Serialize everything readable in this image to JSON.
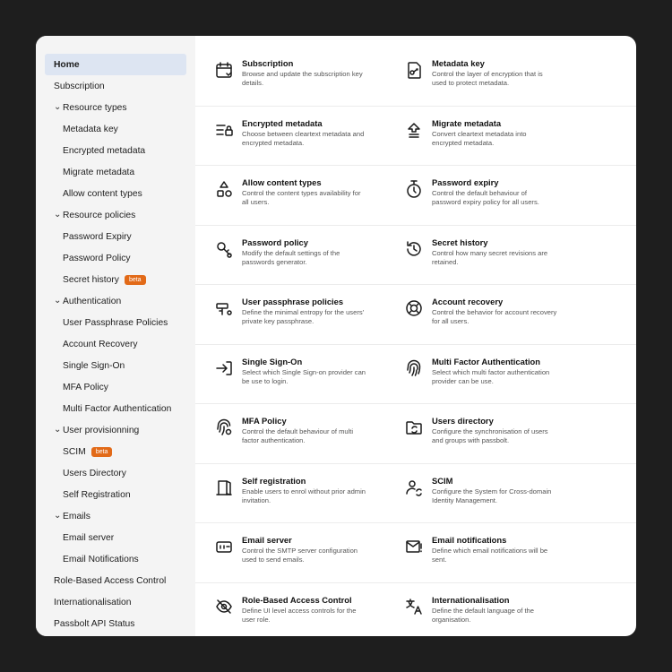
{
  "sidebar": {
    "items": [
      {
        "label": "Home",
        "level": 0,
        "active": true
      },
      {
        "label": "Subscription",
        "level": 0
      },
      {
        "label": "Resource types",
        "level": 1,
        "chevron": true
      },
      {
        "label": "Metadata key",
        "level": 2
      },
      {
        "label": "Encrypted metadata",
        "level": 2
      },
      {
        "label": "Migrate metadata",
        "level": 2
      },
      {
        "label": "Allow content types",
        "level": 2
      },
      {
        "label": "Resource policies",
        "level": 1,
        "chevron": true
      },
      {
        "label": "Password Expiry",
        "level": 2
      },
      {
        "label": "Password Policy",
        "level": 2
      },
      {
        "label": "Secret history",
        "level": 2,
        "badge": "beta"
      },
      {
        "label": "Authentication",
        "level": 1,
        "chevron": true
      },
      {
        "label": "User Passphrase Policies",
        "level": 2
      },
      {
        "label": "Account Recovery",
        "level": 2
      },
      {
        "label": "Single Sign-On",
        "level": 2
      },
      {
        "label": "MFA Policy",
        "level": 2
      },
      {
        "label": "Multi Factor Authentication",
        "level": 2
      },
      {
        "label": "User provisionning",
        "level": 1,
        "chevron": true
      },
      {
        "label": "SCIM",
        "level": 2,
        "badge": "beta"
      },
      {
        "label": "Users Directory",
        "level": 2
      },
      {
        "label": "Self Registration",
        "level": 2
      },
      {
        "label": "Emails",
        "level": 1,
        "chevron": true
      },
      {
        "label": "Email server",
        "level": 2
      },
      {
        "label": "Email Notifications",
        "level": 2
      },
      {
        "label": "Role-Based Access Control",
        "level": 0
      },
      {
        "label": "Internationalisation",
        "level": 0
      },
      {
        "label": "Passbolt API Status",
        "level": 0
      }
    ]
  },
  "cards": [
    {
      "title": "Subscription",
      "desc": "Browse and update the subscription key details.",
      "icon": "calendar-check-icon"
    },
    {
      "title": "Metadata key",
      "desc": "Control the layer of encryption that is used to protect metadata.",
      "icon": "file-key-icon"
    },
    {
      "title": "Encrypted metadata",
      "desc": "Choose between cleartext metadata and encrypted metadata.",
      "icon": "list-lock-icon"
    },
    {
      "title": "Migrate metadata",
      "desc": "Convert cleartext metadata into encrypted metadata.",
      "icon": "upload-arrow-icon"
    },
    {
      "title": "Allow content types",
      "desc": "Control the content types availability for all users.",
      "icon": "shapes-icon"
    },
    {
      "title": "Password expiry",
      "desc": "Control the default behaviour of password expiry policy for all users.",
      "icon": "timer-icon"
    },
    {
      "title": "Password policy",
      "desc": "Modify the default settings of the passwords generator.",
      "icon": "key-gear-icon"
    },
    {
      "title": "Secret history",
      "desc": "Control how many secret revisions are retained.",
      "icon": "history-icon"
    },
    {
      "title": "User passphrase policies",
      "desc": "Define the minimal entropy for the users' private key passphrase.",
      "icon": "key-settings-icon"
    },
    {
      "title": "Account recovery",
      "desc": "Control the behavior for account recovery for all users.",
      "icon": "lifebuoy-icon"
    },
    {
      "title": "Single Sign-On",
      "desc": "Select which Single Sign-on provider can be use to login.",
      "icon": "sign-in-icon"
    },
    {
      "title": "Multi Factor Authentication",
      "desc": "Select which multi factor authentication provider can be use.",
      "icon": "fingerprint-icon"
    },
    {
      "title": "MFA Policy",
      "desc": "Control the default behaviour of multi factor authentication.",
      "icon": "fingerprint-gear-icon"
    },
    {
      "title": "Users directory",
      "desc": "Configure the synchronisation of users and groups with passbolt.",
      "icon": "folder-sync-icon"
    },
    {
      "title": "Self registration",
      "desc": "Enable users to enrol without prior admin invitation.",
      "icon": "door-icon"
    },
    {
      "title": "SCIM",
      "desc": "Configure the System for Cross-domain Identity Management.",
      "icon": "user-sync-icon"
    },
    {
      "title": "Email server",
      "desc": "Control the SMTP server configuration used to send emails.",
      "icon": "mail-server-icon"
    },
    {
      "title": "Email notifications",
      "desc": "Define which email notifications will be sent.",
      "icon": "mail-alert-icon"
    },
    {
      "title": "Role-Based Access Control",
      "desc": "Define UI level access controls for the user role.",
      "icon": "eye-off-icon"
    },
    {
      "title": "Internationalisation",
      "desc": "Define the default language of the organisation.",
      "icon": "translate-icon"
    }
  ]
}
